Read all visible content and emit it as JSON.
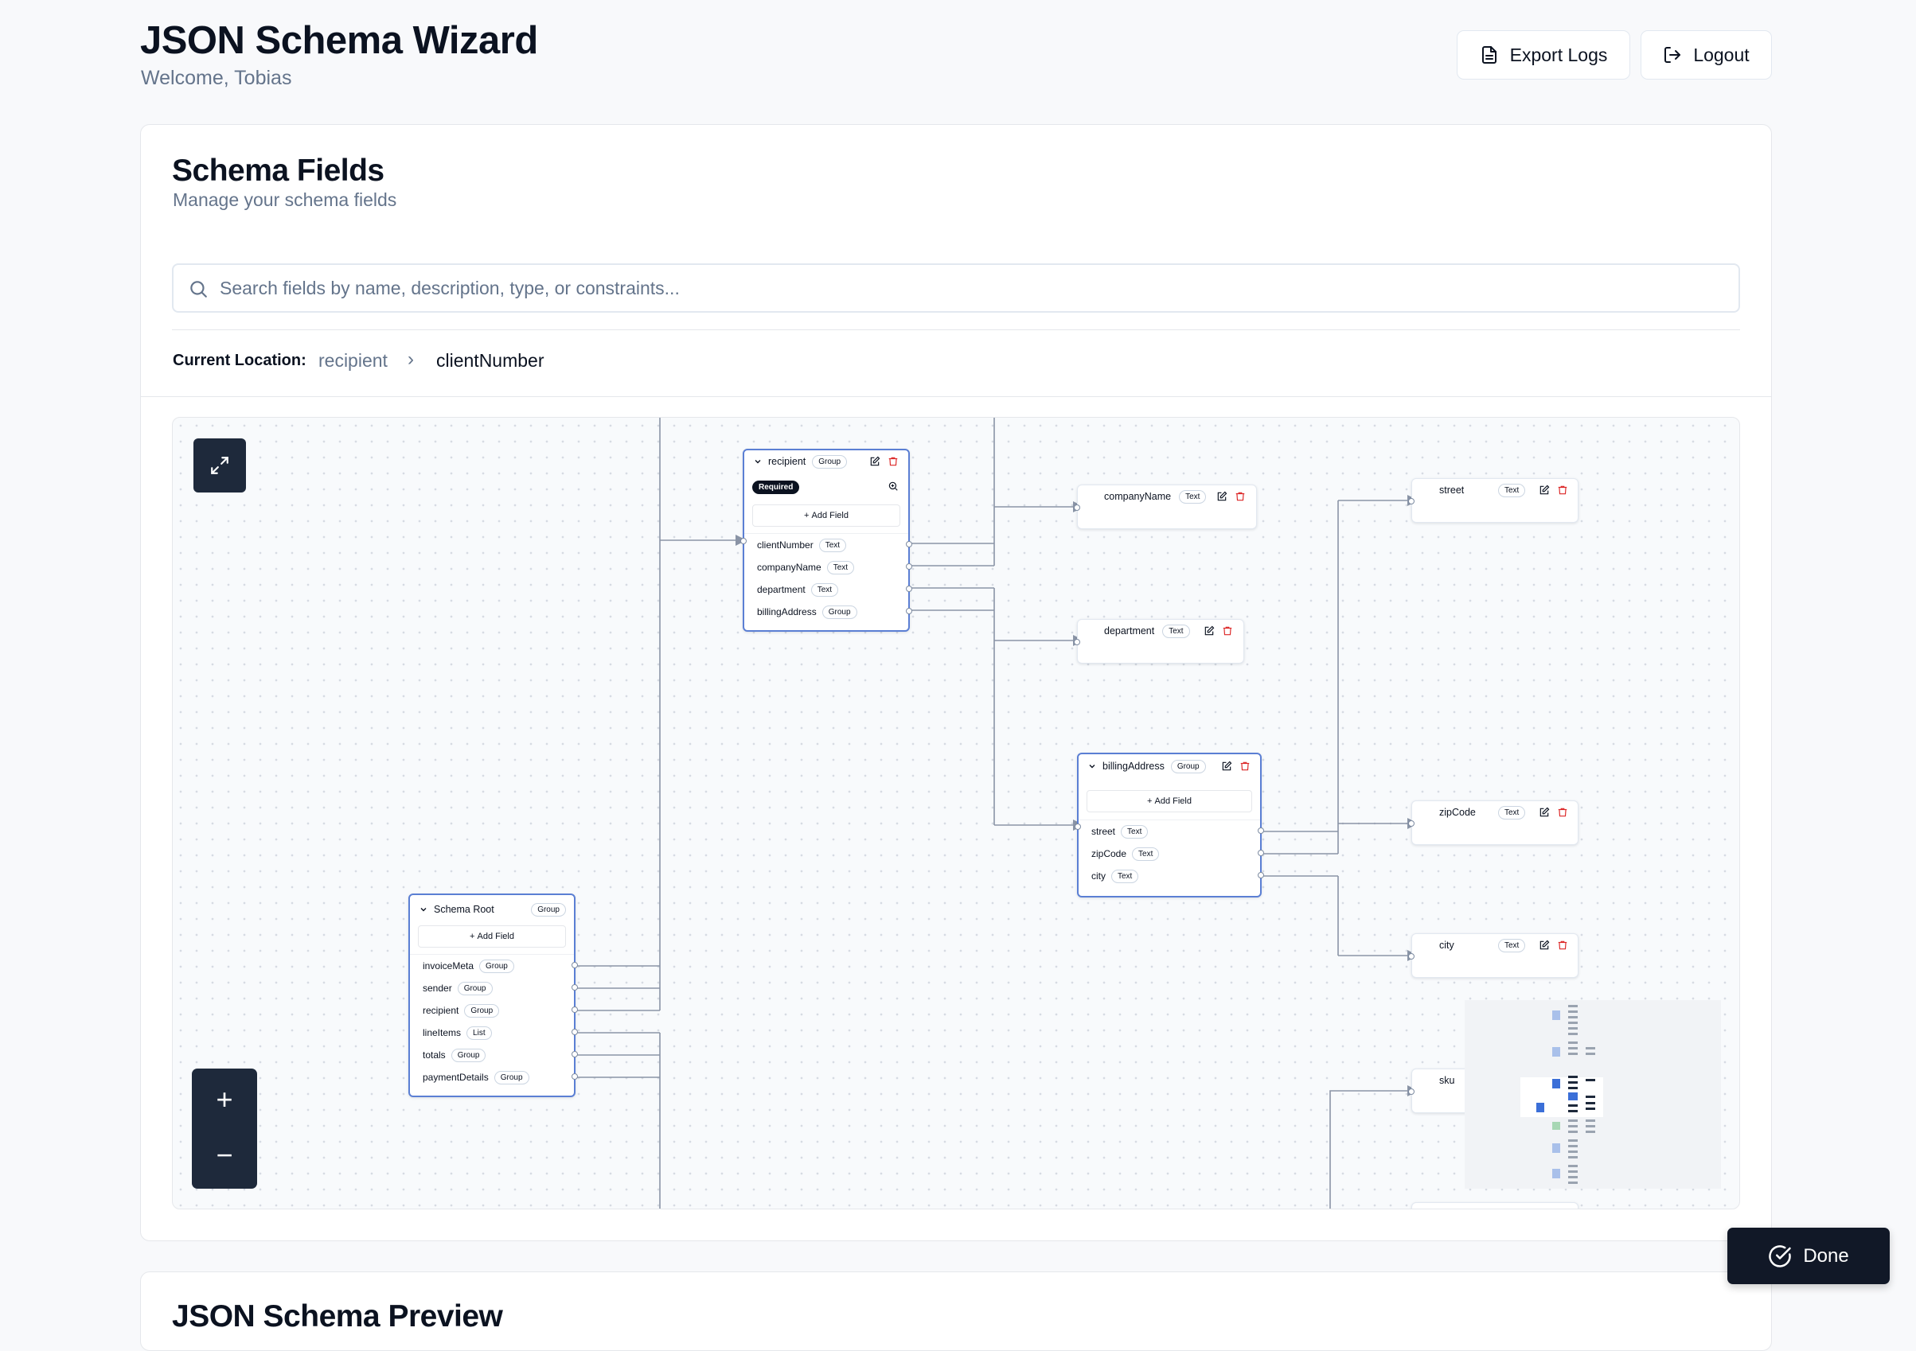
{
  "header": {
    "title": "JSON Schema Wizard",
    "welcome": "Welcome, Tobias",
    "export_label": "Export Logs",
    "logout_label": "Logout"
  },
  "fields_card": {
    "title": "Schema Fields",
    "subtitle": "Manage your schema fields",
    "search_placeholder": "Search fields by name, description, type, or constraints...",
    "search_value": "",
    "breadcrumb_label": "Current Location:",
    "breadcrumb": [
      "recipient",
      "clientNumber"
    ],
    "breadcrumb_separator": "›"
  },
  "graph": {
    "root": {
      "name": "Schema Root",
      "type": "Group",
      "add_label": "Add Field",
      "children": [
        {
          "name": "invoiceMeta",
          "type": "Group"
        },
        {
          "name": "sender",
          "type": "Group"
        },
        {
          "name": "recipient",
          "type": "Group"
        },
        {
          "name": "lineItems",
          "type": "List"
        },
        {
          "name": "totals",
          "type": "Group"
        },
        {
          "name": "paymentDetails",
          "type": "Group"
        }
      ]
    },
    "recipient": {
      "name": "recipient",
      "type": "Group",
      "required_label": "Required",
      "add_label": "Add Field",
      "children": [
        {
          "name": "clientNumber",
          "type": "Text"
        },
        {
          "name": "companyName",
          "type": "Text"
        },
        {
          "name": "department",
          "type": "Text"
        },
        {
          "name": "billingAddress",
          "type": "Group"
        }
      ]
    },
    "billing": {
      "name": "billingAddress",
      "type": "Group",
      "add_label": "Add Field",
      "children": [
        {
          "name": "street",
          "type": "Text"
        },
        {
          "name": "zipCode",
          "type": "Text"
        },
        {
          "name": "city",
          "type": "Text"
        }
      ]
    },
    "leaves": {
      "companyName": {
        "name": "companyName",
        "type": "Text"
      },
      "department": {
        "name": "department",
        "type": "Text"
      },
      "street": {
        "name": "street",
        "type": "Text"
      },
      "zipCode": {
        "name": "zipCode",
        "type": "Text"
      },
      "city": {
        "name": "city",
        "type": "Text"
      },
      "sku": {
        "name": "sku"
      }
    }
  },
  "controls": {
    "zoom_in": "+",
    "zoom_out": "−"
  },
  "done_label": "Done",
  "preview_card": {
    "title": "JSON Schema Preview"
  },
  "colors": {
    "accent_dark": "#111827",
    "selected_border": "#5b7fd4",
    "delete_red": "#dc2626",
    "edge": "#8a94a6"
  }
}
